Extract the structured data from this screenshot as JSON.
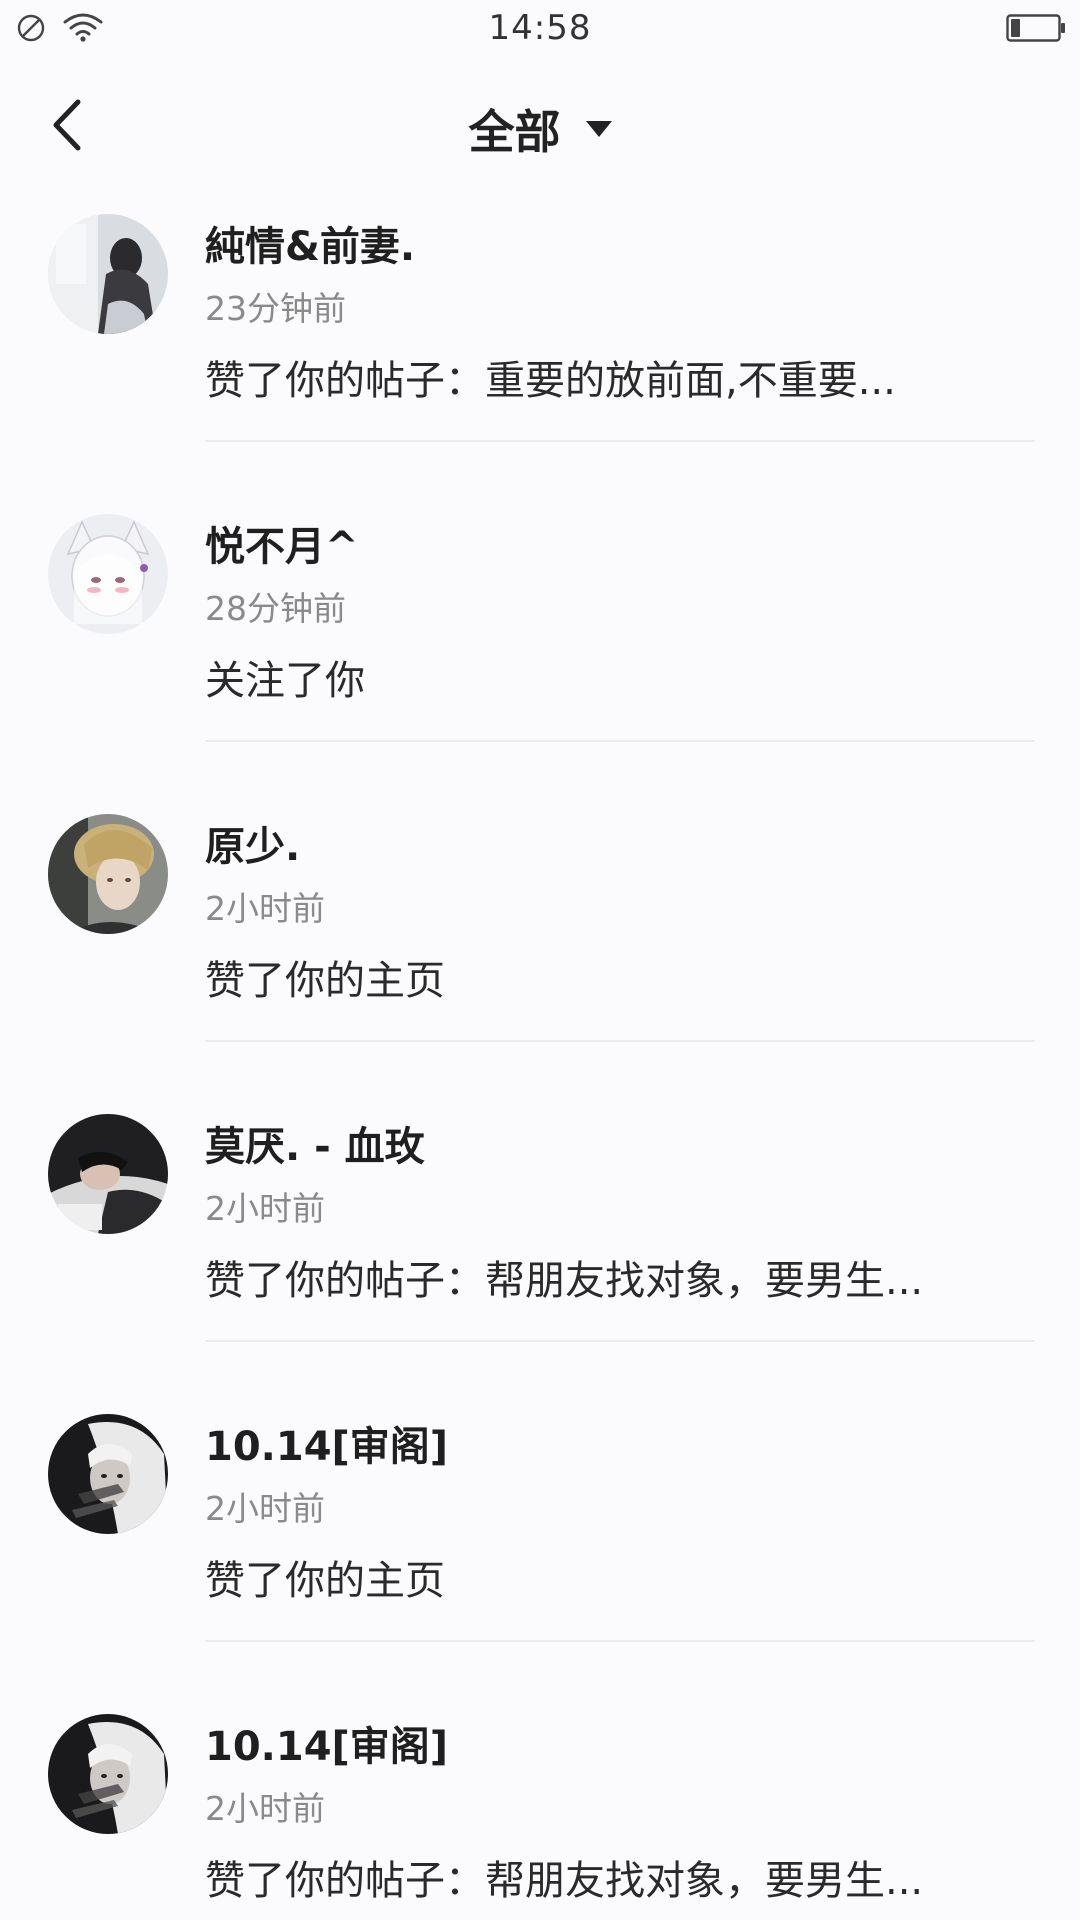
{
  "status_bar": {
    "time": "14:58",
    "icons": [
      "do-not-disturb-icon",
      "wifi-icon",
      "battery-icon"
    ],
    "battery_level": 0.2
  },
  "header": {
    "back_icon": "chevron-left-icon",
    "title": "全部",
    "dropdown_icon": "caret-down-icon"
  },
  "notifications": [
    {
      "name": "純情&前妻.",
      "time": "23分钟前",
      "action": "赞了你的帖子：重要的放前面,不重要..."
    },
    {
      "name": "悦不月^",
      "time": "28分钟前",
      "action": "关注了你"
    },
    {
      "name": "原少.",
      "time": "2小时前",
      "action": "赞了你的主页"
    },
    {
      "name": "莫厌. - 血玫",
      "time": "2小时前",
      "action": "赞了你的帖子：帮朋友找对象，要男生..."
    },
    {
      "name": "10.14[审阁]",
      "time": "2小时前",
      "action": "赞了你的主页"
    },
    {
      "name": "10.14[审阁]",
      "time": "2小时前",
      "action": "赞了你的帖子：帮朋友找对象，要男生..."
    }
  ],
  "colors": {
    "background": "#fbfbfd",
    "name": "#1f1f1f",
    "timestamp": "#8a8a8a",
    "divider": "#ececec"
  }
}
